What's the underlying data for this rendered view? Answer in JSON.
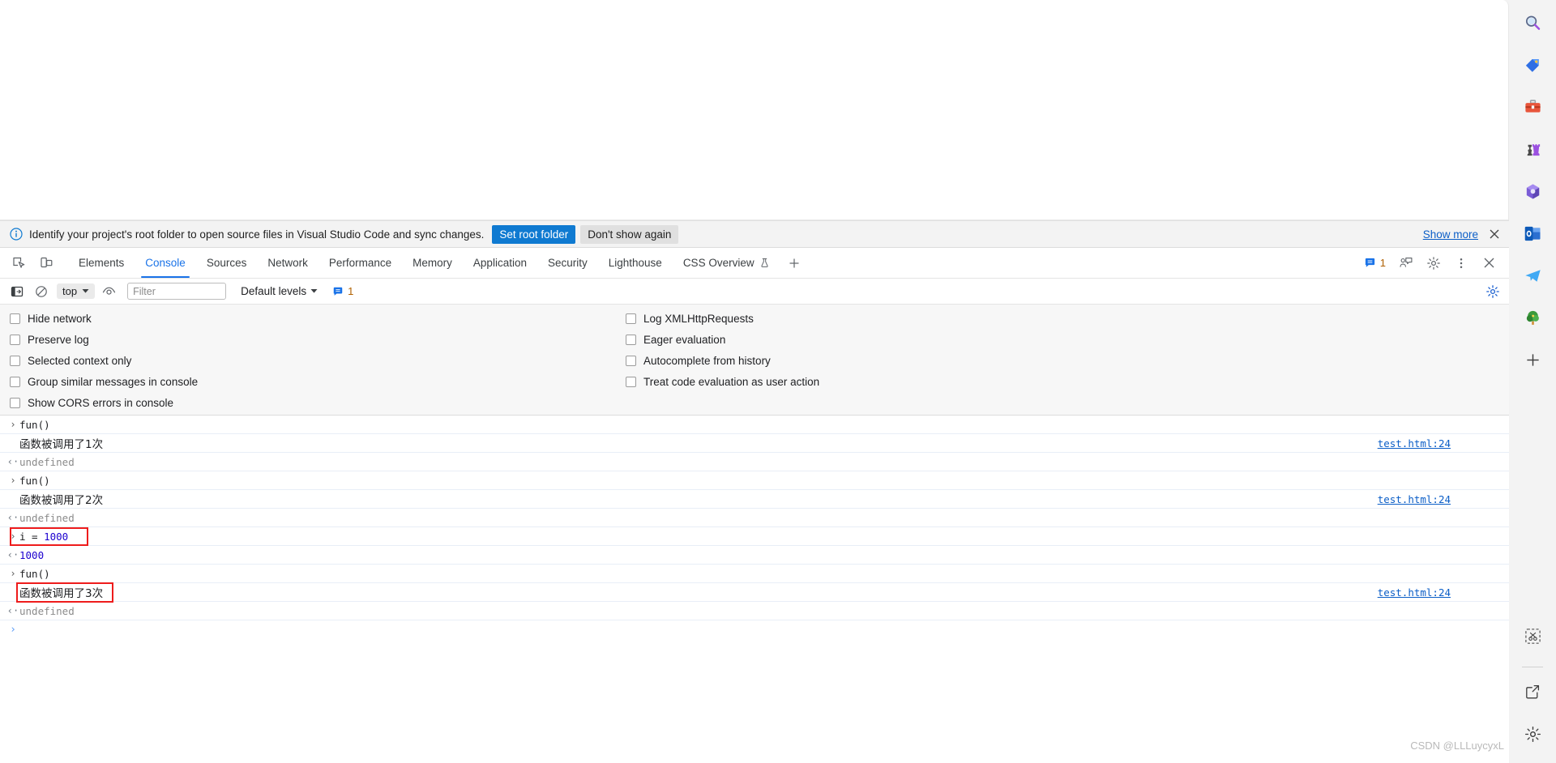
{
  "banner": {
    "icon": "info-circle-icon",
    "message": "Identify your project's root folder to open source files in Visual Studio Code and sync changes.",
    "primary_button": "Set root folder",
    "secondary_button": "Don't show again",
    "show_more": "Show more",
    "close_icon": "close-icon",
    "primary_color": "#0f7ad1"
  },
  "devtools": {
    "left_icons": [
      "inspect-element-icon",
      "device-toolbar-icon"
    ],
    "tabs": [
      {
        "label": "Elements",
        "active": false
      },
      {
        "label": "Console",
        "active": true
      },
      {
        "label": "Sources",
        "active": false
      },
      {
        "label": "Network",
        "active": false
      },
      {
        "label": "Performance",
        "active": false
      },
      {
        "label": "Memory",
        "active": false
      },
      {
        "label": "Application",
        "active": false
      },
      {
        "label": "Security",
        "active": false
      },
      {
        "label": "Lighthouse",
        "active": false
      },
      {
        "label": "CSS Overview",
        "active": false,
        "flask": true
      }
    ],
    "add_tab_icon": "plus-icon",
    "right_icons": [
      "issues-icon",
      "feedback-icon",
      "settings-gear-icon",
      "more-options-icon",
      "close-devtools-icon"
    ],
    "message_count": "1",
    "accent_color": "#1a73e8"
  },
  "console_toolbar": {
    "sidebar_toggle_icon": "console-sidebar-icon",
    "clear_icon": "clear-console-icon",
    "context": "top",
    "context_chevron": "chevron-down-icon",
    "eye_icon": "live-expression-icon",
    "filter_placeholder": "Filter",
    "filter_value": "",
    "levels": "Default levels",
    "levels_chevron": "chevron-down-icon",
    "badge_count": "1",
    "settings_icon": "settings-gear-icon"
  },
  "console_settings": {
    "left": [
      {
        "label": "Hide network",
        "checked": false
      },
      {
        "label": "Preserve log",
        "checked": false
      },
      {
        "label": "Selected context only",
        "checked": false
      },
      {
        "label": "Group similar messages in console",
        "checked": false
      },
      {
        "label": "Show CORS errors in console",
        "checked": false
      }
    ],
    "right": [
      {
        "label": "Log XMLHttpRequests",
        "checked": false
      },
      {
        "label": "Eager evaluation",
        "checked": false
      },
      {
        "label": "Autocomplete from history",
        "checked": false
      },
      {
        "label": "Treat code evaluation as user action",
        "checked": false
      }
    ]
  },
  "console_log": {
    "rows": [
      {
        "kind": "input",
        "marker": "›",
        "text": "fun()",
        "style": "code",
        "source": "",
        "highlight": false
      },
      {
        "kind": "log",
        "marker": "",
        "text": "函数被调用了1次",
        "style": "cjk",
        "source": "test.html:24",
        "highlight": false
      },
      {
        "kind": "output",
        "marker": "‹·",
        "text": "undefined",
        "style": "muted",
        "source": "",
        "highlight": false
      },
      {
        "kind": "input",
        "marker": "›",
        "text": "fun()",
        "style": "code",
        "source": "",
        "highlight": false
      },
      {
        "kind": "log",
        "marker": "",
        "text": "函数被调用了2次",
        "style": "cjk",
        "source": "test.html:24",
        "highlight": false
      },
      {
        "kind": "output",
        "marker": "‹·",
        "text": "undefined",
        "style": "muted",
        "source": "",
        "highlight": false
      },
      {
        "kind": "input",
        "marker": "›",
        "text": "i = 1000",
        "style": "code-number",
        "source": "",
        "highlight": true
      },
      {
        "kind": "output",
        "marker": "‹·",
        "text": "1000",
        "style": "number",
        "source": "",
        "highlight": false
      },
      {
        "kind": "input",
        "marker": "›",
        "text": "fun()",
        "style": "code",
        "source": "",
        "highlight": false
      },
      {
        "kind": "log",
        "marker": "",
        "text": "函数被调用了3次",
        "style": "cjk",
        "source": "test.html:24",
        "highlight": true
      },
      {
        "kind": "output",
        "marker": "‹·",
        "text": "undefined",
        "style": "muted",
        "source": "",
        "highlight": false
      },
      {
        "kind": "prompt",
        "marker": "›",
        "text": "",
        "style": "code",
        "source": "",
        "highlight": false
      }
    ],
    "expression_text": "i = ",
    "expression_value": "1000",
    "highlight_color": "#ee1c1c"
  },
  "edge_sidebar": {
    "top_icons": [
      {
        "name": "search-icon",
        "glyph": "🔍"
      },
      {
        "name": "shopping-tag-icon",
        "glyph": "🏷"
      },
      {
        "name": "tools-briefcase-icon",
        "glyph": "🧰"
      },
      {
        "name": "games-icon",
        "glyph": "♟"
      },
      {
        "name": "microsoft-365-icon",
        "glyph": "⬡"
      },
      {
        "name": "outlook-icon",
        "glyph": "✉"
      },
      {
        "name": "telegram-icon",
        "glyph": "✈"
      },
      {
        "name": "tree-icon",
        "glyph": "🌲"
      },
      {
        "name": "add-sidebar-app-icon",
        "glyph": "＋"
      }
    ],
    "bottom_icons": [
      {
        "name": "screenshot-capture-icon",
        "glyph": "✂"
      },
      {
        "name": "open-in-new-window-icon",
        "glyph": "↗"
      },
      {
        "name": "sidebar-settings-icon",
        "glyph": "⚙"
      }
    ]
  },
  "watermark": "CSDN @LLLuycyxL"
}
